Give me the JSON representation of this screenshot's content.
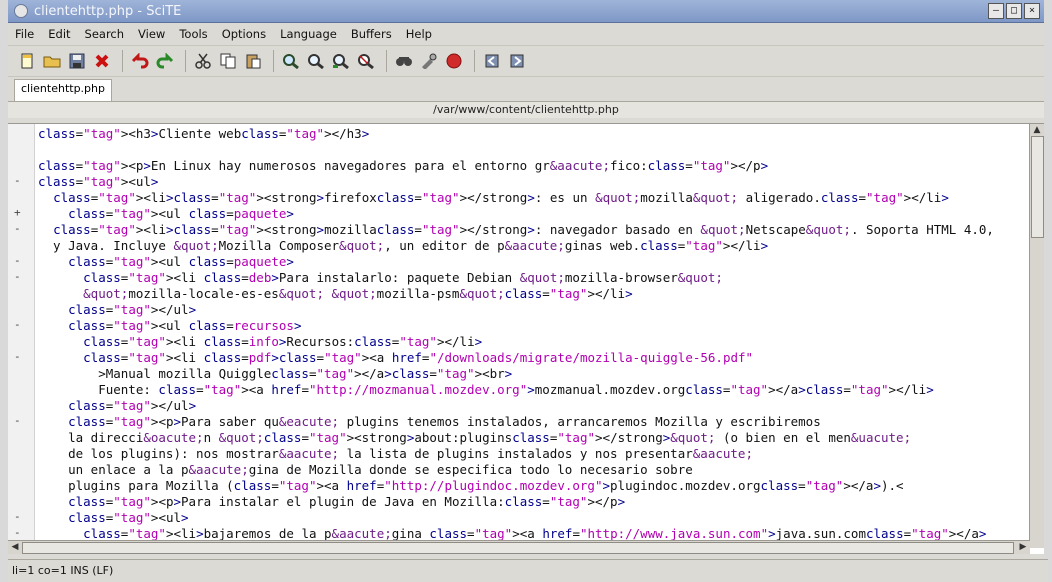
{
  "window": {
    "title": "clientehttp.php - SciTE"
  },
  "menu": [
    "File",
    "Edit",
    "Search",
    "View",
    "Tools",
    "Options",
    "Language",
    "Buffers",
    "Help"
  ],
  "tabs": [
    {
      "label": "clientehttp.php"
    }
  ],
  "path": "/var/www/content/clientehttp.php",
  "status": "li=1 co=1 INS (LF)",
  "toolbar_icons": [
    "new-file-icon",
    "open-folder-icon",
    "save-icon",
    "close-icon",
    "undo-icon",
    "redo-icon",
    "cut-icon",
    "copy-icon",
    "paste-icon",
    "find-icon",
    "find-next-icon",
    "find-prev-icon",
    "replace-icon",
    "find-in-files-icon",
    "build-icon",
    "stop-icon",
    "previous-icon",
    "next-icon"
  ],
  "code_lines": [
    "<h3>Cliente web</h3>",
    "",
    "<p>En Linux hay numerosos navegadores para el entorno gr&aacute;fico:</p>",
    "<ul>",
    "  <li><strong>firefox</strong>: es un &quot;mozilla&quot; aligerado.</li>",
    "    <ul class=paquete>",
    "  <li><strong>mozilla</strong>: navegador basado en &quot;Netscape&quot;. Soporta HTML 4.0,",
    "  y Java. Incluye &quot;Mozilla Composer&quot;, un editor de p&aacute;ginas web.</li>",
    "    <ul class=paquete>",
    "      <li class=deb>Para instalarlo: paquete Debian &quot;mozilla-browser&quot;",
    "      &quot;mozilla-locale-es-es&quot; &quot;mozilla-psm&quot;</li>",
    "    </ul>",
    "    <ul class=recursos>",
    "      <li class=info>Recursos:</li>",
    "      <li class=pdf><a href=\"/downloads/migrate/mozilla-quiggle-56.pdf\"",
    "        >Manual mozilla Quiggle</a><br>",
    "        Fuente: <a href=\"http://mozmanual.mozdev.org\">mozmanual.mozdev.org</a></li>",
    "    </ul>",
    "    <p>Para saber qu&eacute; plugins tenemos instalados, arrancaremos Mozilla y escribiremos",
    "    la direcci&oacute;n &quot;<strong>about:plugins</strong>&quot; (o bien en el men&uacute;",
    "    de los plugins): nos mostrar&aacute; la lista de plugins instalados y nos presentar&aacute;",
    "    un enlace a la p&aacute;gina de Mozilla donde se especifica todo lo necesario sobre",
    "    plugins para Mozilla (<a href=\"http://plugindoc.mozdev.org\">plugindoc.mozdev.org</a>).<",
    "    <p>Para instalar el plugin de Java en Mozilla:</p>",
    "    <ul>",
    "      <li>bajaremos de la p&aacute;gina <a href=\"http://www.java.sun.com\">java.sun.com</a>"
  ],
  "fold_marks": [
    "",
    "",
    "",
    "-",
    "",
    "+",
    "-",
    "",
    "-",
    "-",
    "",
    "",
    "-",
    "",
    "-",
    "",
    "",
    "",
    "-",
    "",
    "",
    "",
    "",
    "",
    "-",
    "-"
  ],
  "colors": {
    "tag": "#00008b",
    "value": "#b100b1",
    "entity": "#6e1d86",
    "title_bg": "#8aa2cf"
  }
}
